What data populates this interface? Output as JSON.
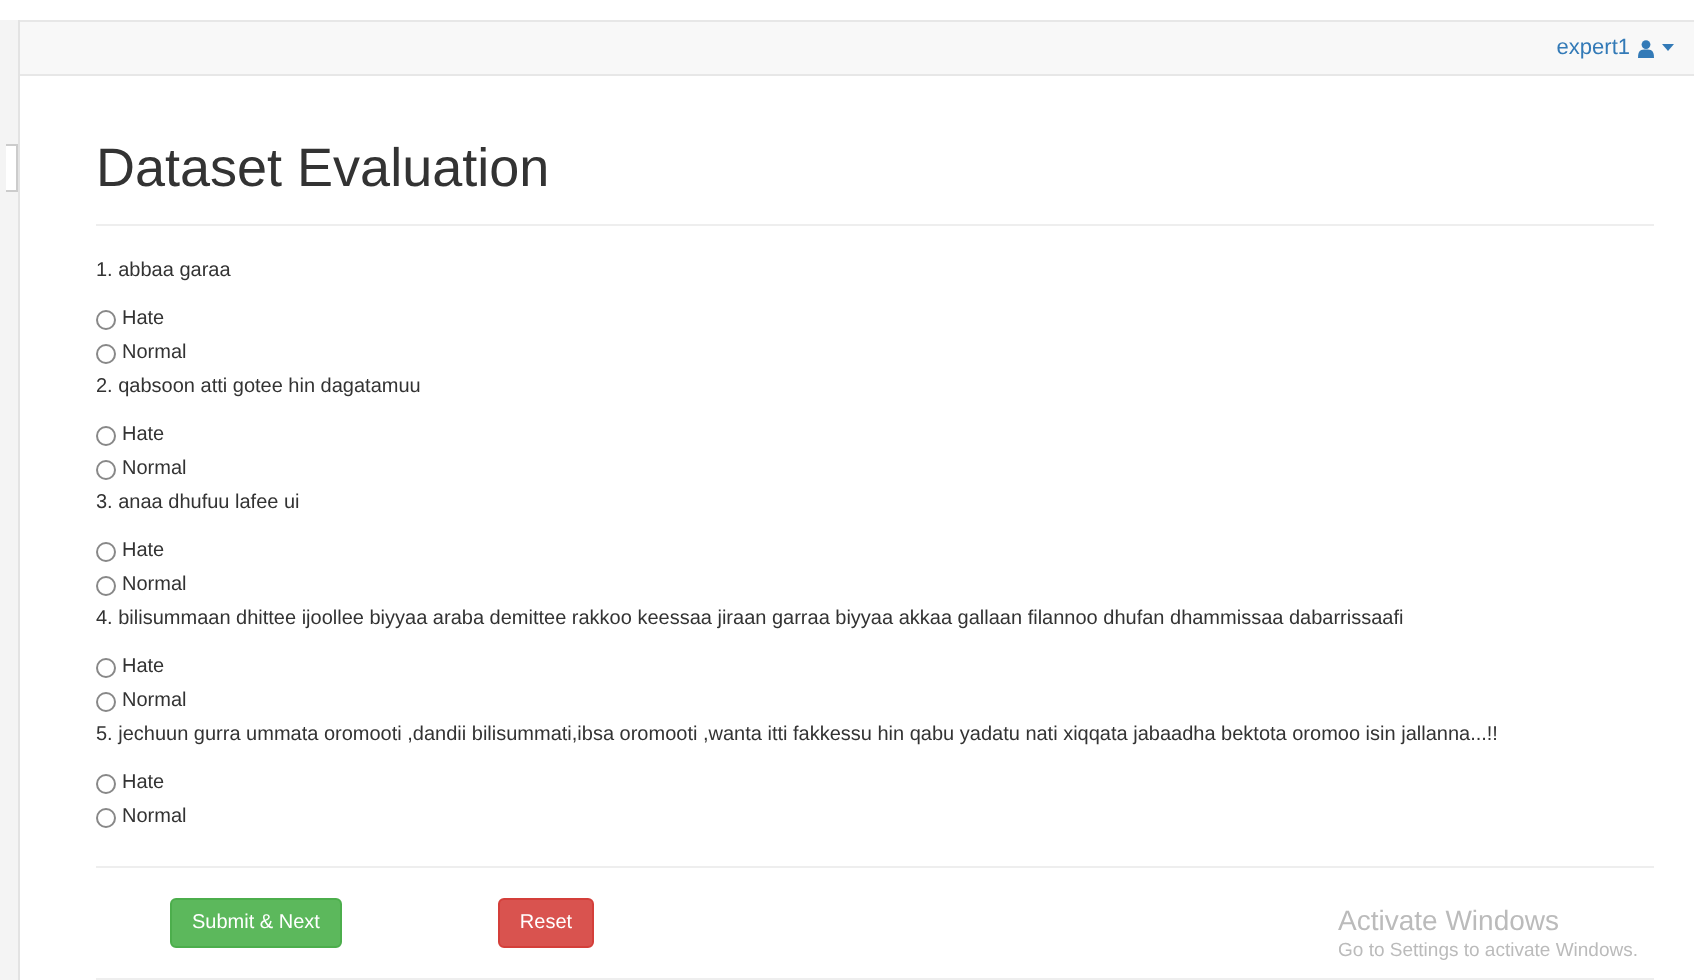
{
  "navbar": {
    "user": "expert1"
  },
  "title": "Dataset Evaluation",
  "questions": [
    {
      "text": "1. abbaa garaa",
      "options": [
        {
          "label": "Hate",
          "selected": false
        },
        {
          "label": "Normal",
          "selected": false
        }
      ]
    },
    {
      "text": "2. qabsoon atti gotee hin dagatamuu",
      "options": [
        {
          "label": "Hate",
          "selected": false
        },
        {
          "label": "Normal",
          "selected": false
        }
      ]
    },
    {
      "text": "3. anaa dhufuu lafee ui",
      "options": [
        {
          "label": "Hate",
          "selected": false
        },
        {
          "label": "Normal",
          "selected": false
        }
      ]
    },
    {
      "text": "4. bilisummaan dhittee ijoollee biyyaa araba demittee rakkoo keessaa jiraan garraa biyyaa akkaa gallaan filannoo dhufan dhammissaa dabarrissaafi",
      "options": [
        {
          "label": "Hate",
          "selected": false
        },
        {
          "label": "Normal",
          "selected": false
        }
      ]
    },
    {
      "text": "5. jechuun gurra ummata oromooti ,dandii bilisummati,ibsa oromooti ,wanta itti fakkessu hin qabu yadatu nati xiqqata jabaadha bektota oromoo isin jallanna...!!",
      "options": [
        {
          "label": "Hate",
          "selected": false
        },
        {
          "label": "Normal",
          "selected": false
        }
      ]
    }
  ],
  "buttons": [
    {
      "label": "Submit & Next",
      "kind": "primary"
    },
    {
      "label": "Reset",
      "kind": "danger"
    }
  ],
  "os_notice": {
    "title": "Activate Windows",
    "subtitle": "Go to Settings to activate Windows."
  }
}
